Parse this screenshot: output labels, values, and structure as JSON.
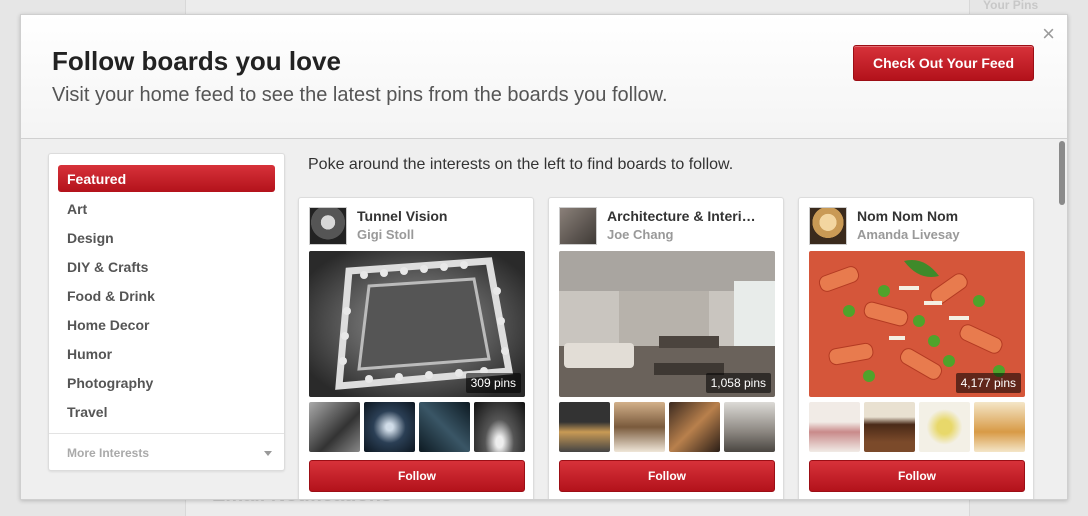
{
  "background": {
    "your_pins": "Your Pins",
    "email_notifications": "Email Notifications"
  },
  "modal": {
    "title": "Follow boards you love",
    "subtitle": "Visit your home feed to see the latest pins from the boards you follow.",
    "close_icon": "×",
    "feed_button": "Check Out Your Feed"
  },
  "sidebar": {
    "items": [
      {
        "label": "Featured",
        "active": true
      },
      {
        "label": "Art"
      },
      {
        "label": "Design"
      },
      {
        "label": "DIY & Crafts"
      },
      {
        "label": "Food & Drink"
      },
      {
        "label": "Home Decor"
      },
      {
        "label": "Humor"
      },
      {
        "label": "Photography"
      },
      {
        "label": "Travel"
      }
    ],
    "more": "More Interests"
  },
  "intro": "Poke around the interests on the left to find boards to follow.",
  "boards": [
    {
      "title": "Tunnel Vision",
      "author": "Gigi Stoll",
      "pins": "309 pins",
      "follow": "Follow"
    },
    {
      "title": "Architecture & Interi…",
      "author": "Joe Chang",
      "pins": "1,058 pins",
      "follow": "Follow"
    },
    {
      "title": "Nom Nom Nom",
      "author": "Amanda Livesay",
      "pins": "4,177 pins",
      "follow": "Follow"
    }
  ],
  "colors": {
    "accent": "#c8202a",
    "text": "#333333"
  }
}
